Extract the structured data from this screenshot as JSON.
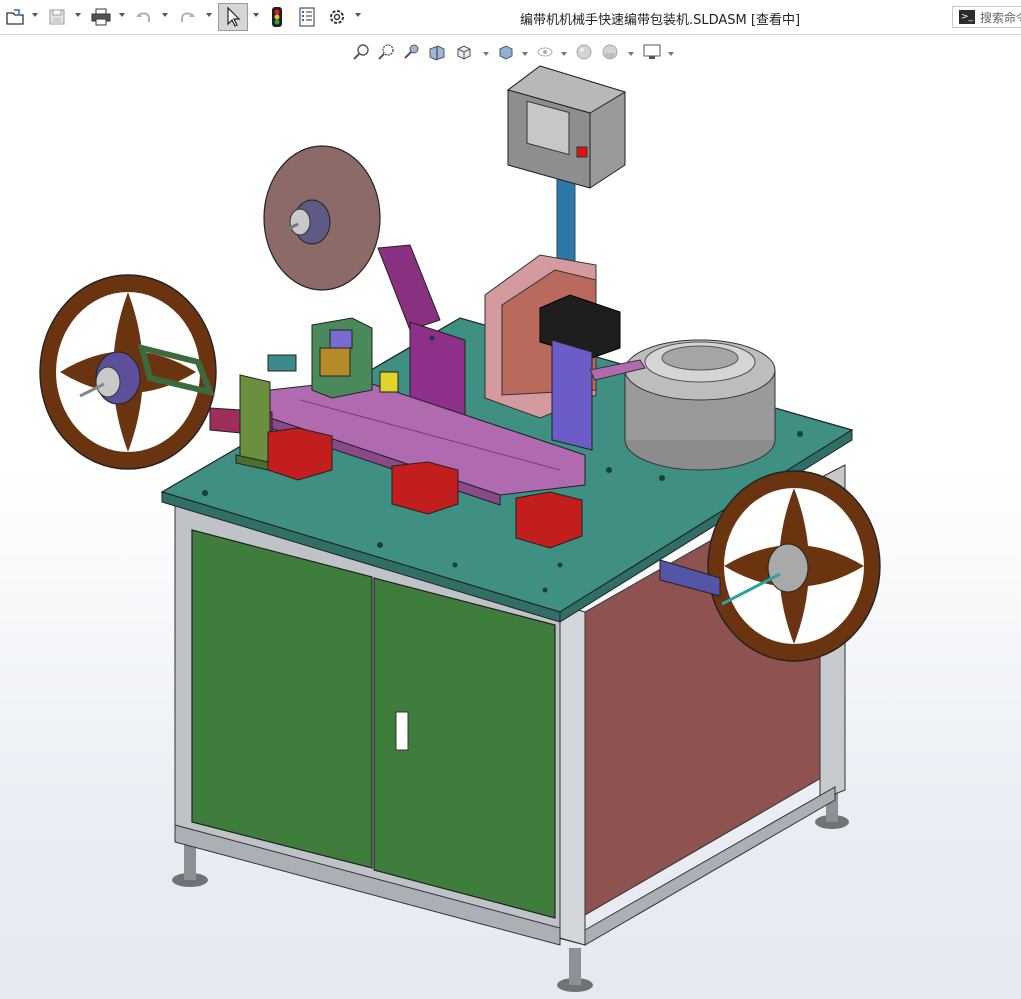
{
  "window": {
    "title": "编带机机械手快速编带包装机.SLDASM [查看中]"
  },
  "search": {
    "placeholder": "搜索命令",
    "visible_text": "搜索命令"
  },
  "toolbar": {
    "items": [
      {
        "icon": "open-file-icon",
        "dropdown": true
      },
      {
        "icon": "save-icon",
        "dropdown": true
      },
      {
        "icon": "print-icon",
        "dropdown": true
      },
      {
        "icon": "undo-icon",
        "dropdown": true
      },
      {
        "icon": "redo-icon",
        "dropdown": true
      },
      {
        "icon": "select-pointer-icon",
        "dropdown": true,
        "active": true
      },
      {
        "icon": "rebuild-traffic-light-icon"
      },
      {
        "icon": "file-properties-icon"
      },
      {
        "icon": "options-gear-icon",
        "dropdown": true
      }
    ]
  },
  "heads_up_toolbar": {
    "items": [
      "zoom-to-fit-icon",
      "zoom-to-area-icon",
      "previous-view-icon",
      "section-view-icon",
      "view-orientation-icon",
      "display-style-icon",
      "hide-show-items-icon",
      "edit-appearance-icon",
      "apply-scene-icon",
      "view-settings-icon"
    ]
  },
  "colors": {
    "table_top": "#3f8f82",
    "door_green": "#3f7d3d",
    "side_panel": "#8e5350",
    "reel_brown": "#6a3411",
    "frame_gray": "#bfc3c7",
    "red_block": "#c21e1e",
    "magenta_rail": "#b06ab0",
    "control_box": "#9a9a9a"
  }
}
